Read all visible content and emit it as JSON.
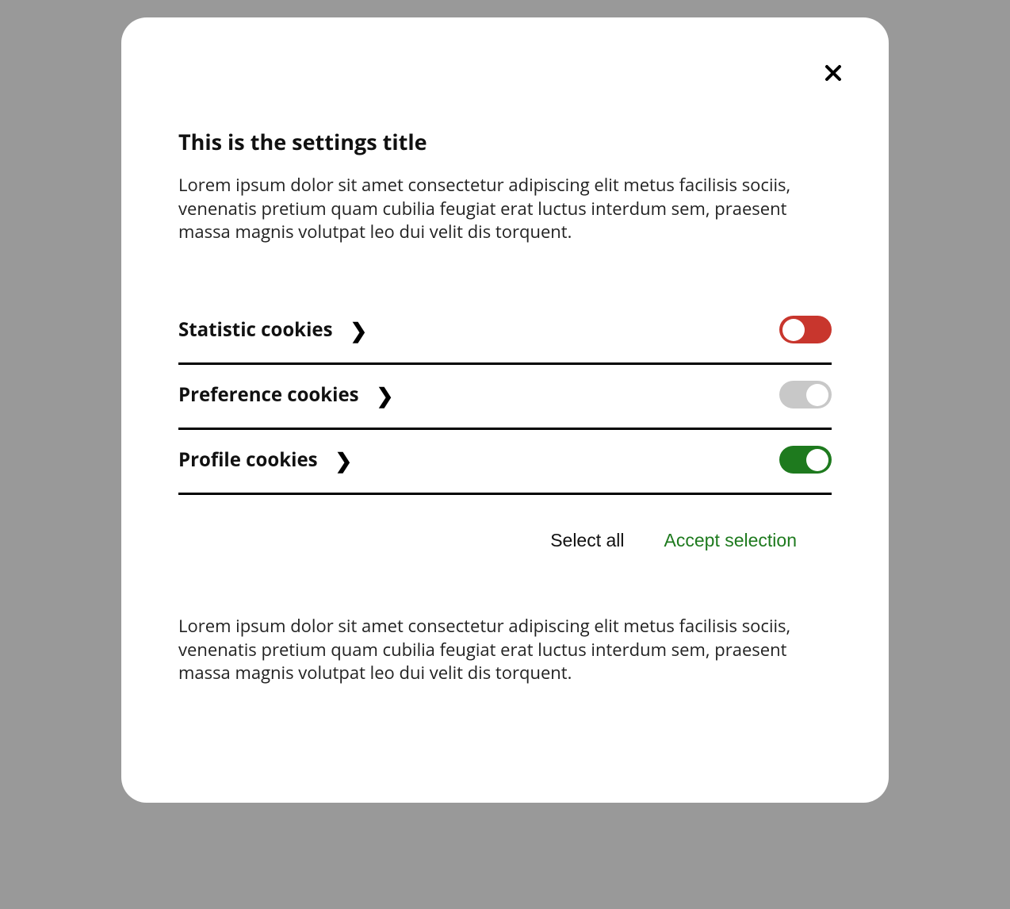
{
  "title": "This is the settings title",
  "intro": "Lorem ipsum dolor sit amet consectetur adipiscing elit metus facilisis sociis, venenatis pretium quam cubilia feugiat erat luctus interdum sem, praesent massa magnis volutpat leo dui velit dis torquent.",
  "categories": [
    {
      "label": "Statistic cookies",
      "state": "red"
    },
    {
      "label": "Preference cookies",
      "state": "grey"
    },
    {
      "label": "Profile cookies",
      "state": "green"
    }
  ],
  "actions": {
    "select_all": "Select all",
    "accept": "Accept selection"
  },
  "outro": "Lorem ipsum dolor sit amet consectetur adipiscing elit metus facilisis sociis, venenatis pretium quam cubilia feugiat erat luctus interdum sem, praesent massa magnis volutpat leo dui velit dis torquent."
}
